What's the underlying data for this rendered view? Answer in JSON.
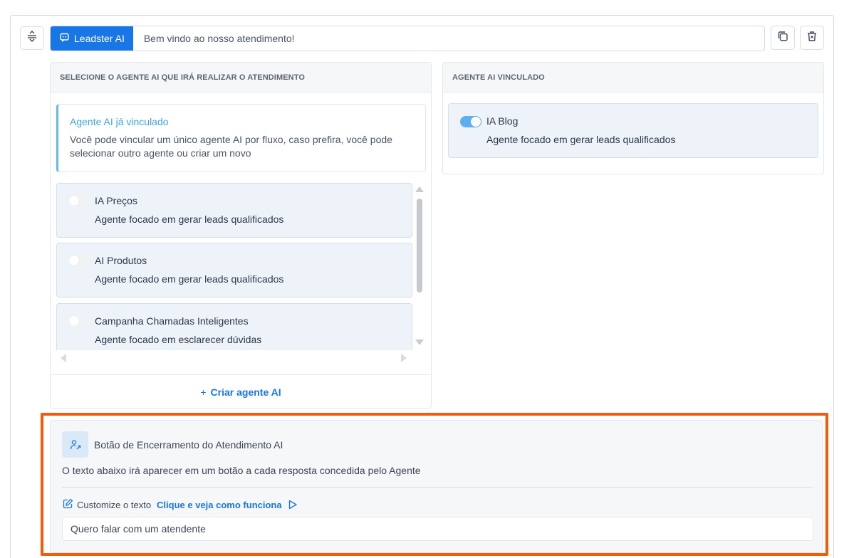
{
  "header": {
    "badge_label": "Leadster AI",
    "message_text": "Bem vindo ao nosso atendimento!"
  },
  "left_panel": {
    "title": "SELECIONE O AGENTE AI QUE IRÁ REALIZAR O ATENDIMENTO",
    "info_title": "Agente AI já vinculado",
    "info_text": "Você pode vincular um único agente AI por fluxo, caso prefira, você pode selecionar outro agente ou criar um novo",
    "agents": [
      {
        "name": "IA Preços",
        "description": "Agente focado em gerar leads qualificados",
        "enabled": false
      },
      {
        "name": "AI Produtos",
        "description": "Agente focado em gerar leads qualificados",
        "enabled": false
      },
      {
        "name": "Campanha Chamadas Inteligentes",
        "description": "Agente focado em esclarecer dúvidas",
        "enabled": false
      }
    ],
    "create_icon": "+",
    "create_label": "Criar agente AI"
  },
  "right_panel": {
    "title": "AGENTE AI VINCULADO",
    "linked_agent": {
      "name": "IA Blog",
      "description": "Agente focado em gerar leads qualificados",
      "enabled": true
    }
  },
  "end_section": {
    "title": "Botão de Encerramento do Atendimento AI",
    "description": "O texto abaixo irá aparecer em um botão a cada resposta concedida pelo Agente",
    "customize_label": "Customize o texto",
    "customize_link": "Clique e veja como funciona",
    "input_value": "Quero falar com um atendente"
  },
  "colors": {
    "accent": "#1976e5",
    "highlight_border": "#f45b0a",
    "info_title": "#3ba8e0",
    "toggle_on": "#5faff0"
  }
}
